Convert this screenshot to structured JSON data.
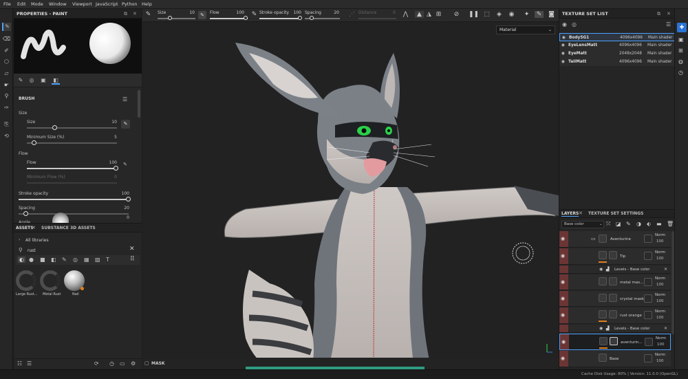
{
  "menu": [
    "File",
    "Edit",
    "Mode",
    "Window",
    "Viewport",
    "JavaScript",
    "Python",
    "Help"
  ],
  "tool_options": {
    "size_label": "Size",
    "size_value": "10",
    "flow_label": "Flow",
    "flow_value": "100",
    "stroke_label": "Stroke opacity",
    "stroke_value": "100",
    "spacing_label": "Spacing",
    "spacing_value": "20",
    "distance_label": "Distance",
    "distance_value": "0"
  },
  "properties": {
    "title": "PROPERTIES - PAINT",
    "brush_label": "BRUSH",
    "size_section": "Size",
    "size_label": "Size",
    "size_value": "10",
    "min_size_label": "Minimum Size (%)",
    "min_size_value": "5",
    "flow_section": "Flow",
    "flow_label": "Flow",
    "flow_value": "100",
    "min_flow_label": "Minimum Flow (%)",
    "min_flow_value": "0",
    "stroke_label": "Stroke opacity",
    "stroke_value": "100",
    "spacing_label": "Spacing",
    "spacing_value": "20",
    "angle_label": "Angle",
    "angle_value": "0"
  },
  "assets": {
    "tab1": "ASSETS",
    "tab2": "SUBSTANCE 3D ASSETS",
    "breadcrumb": "All libraries",
    "search_value": "rust",
    "items": [
      {
        "label": "Large Rust..."
      },
      {
        "label": "Metal Rust"
      },
      {
        "label": "Nail"
      }
    ]
  },
  "viewport": {
    "display_mode": "Material"
  },
  "texture_set_list": {
    "title": "TEXTURE SET LIST",
    "rows": [
      {
        "name": "BodySG1",
        "res": "4096x4096",
        "shader": "Main shader"
      },
      {
        "name": "EyeLensMatt",
        "res": "4096x4096",
        "shader": "Main shader"
      },
      {
        "name": "EyeMatt",
        "res": "2048x2048",
        "shader": "Main shader"
      },
      {
        "name": "TailMatt",
        "res": "4096x4096",
        "shader": "Main shader"
      }
    ]
  },
  "layers": {
    "tab1": "LAYERS",
    "tab2": "TEXTURE SET SETTINGS",
    "channel": "Base color",
    "rows": [
      {
        "name": "Aventurine",
        "blend": "Norm",
        "opacity": "100"
      },
      {
        "name": "Tip",
        "blend": "Norm",
        "opacity": "100"
      },
      {
        "name": "Levels - Base color",
        "blend": "",
        "opacity": ""
      },
      {
        "name": "metal mas...",
        "blend": "Norm",
        "opacity": "100"
      },
      {
        "name": "crystal mask",
        "blend": "Norm",
        "opacity": "100"
      },
      {
        "name": "rust orange",
        "blend": "Norm",
        "opacity": "100"
      },
      {
        "name": "Levels - Base color",
        "blend": "",
        "opacity": ""
      },
      {
        "name": "aventurin...",
        "blend": "Norm",
        "opacity": "100"
      },
      {
        "name": "Base",
        "blend": "Norm",
        "opacity": "100"
      }
    ]
  },
  "bottom": {
    "mask_label": "MASK"
  },
  "status": {
    "text": "Cache Disk Usage:   80% | Version: 11.0.0 (OpenGL)"
  },
  "colors": {
    "accent": "#4da3ff",
    "layer_eye": "#6b3535",
    "orange_mask": "#e0801d",
    "progress": "#2f9b82"
  }
}
